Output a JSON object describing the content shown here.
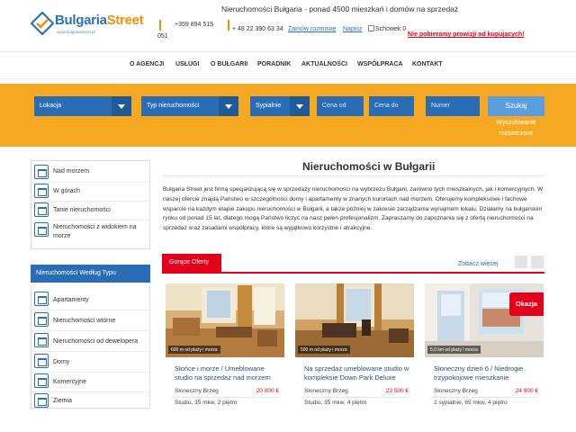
{
  "header": {
    "logo_text_a": "Bulgaria",
    "logo_text_b": "Street",
    "logo_sub": "www.bulgariastreet.pl",
    "title": "Nieruchomości Bułgaria - ponad 4500 mieszkań i domów na sprzedaż",
    "phone1_a": "+359 894 515",
    "phone1_b": "051",
    "phone2": "+ 48 22 390 63 34",
    "order_call": "Zamów rozmowę",
    "write": "Napisz",
    "schowek": "Schowek 0",
    "no_commission": "Nie pobieramy prowizji od kupujących!"
  },
  "menu": {
    "items": [
      "O AGENCJI",
      "USŁUGI",
      "O BUŁGARII",
      "PORADNIK",
      "AKTUALNOŚCI",
      "WSPÓŁPRACA",
      "KONTAKT"
    ]
  },
  "search": {
    "location": "Lokacja",
    "type": "Typ nieruchomości",
    "bedrooms": "Sypialnie",
    "price_from": "Cena od",
    "price_to": "Cena do",
    "number": "Numer",
    "button": "Szukaj",
    "advanced": "Wyszukiwanie rozszerzone"
  },
  "sidebar": {
    "top_items": [
      "Nad morzem",
      "W górach",
      "Tanie nieruchomości",
      "Nieruchomości z widokiem na morze"
    ],
    "heading": "Nieruchomości Według Typu",
    "type_items": [
      "Apartamenty",
      "Nieruchomości wtórne",
      "Nieruchomości od dewelopera",
      "Domy",
      "Komercyjne",
      "Ziemia"
    ]
  },
  "main": {
    "title": "Nieruchomości w Bułgarii",
    "intro": "Bulgaria Street jest firmą specjalizującą się w sprzedaży nieruchomości na wybrzeżu Bułgarii, zarówno tych mieszkalnych, jak i komercyjnych. W naszej ofercie znajdą Państwo w szczególności domy i apartamenty w znanych kurortach nad morzem. Oferujemy kompleksowe i fachowe wsparcie na każdym etapie zakupu nieruchomości w Bułgarii, a także później w zakresie zarządzania wynajmem lokalu. Działamy na bułgarskim rynku od ponad 15 lat, dlatego mogą Państwo liczyć na nasz pełen profesjonalizm. Zapraszamy do zapoznania się z ofertą nieruchomości na sprzedaż oraz zasadami współpracy, które są wyjątkowo korzystne i atrakcyjne.",
    "hot_tab": "Gorące Oferty",
    "see_more": "Zobacz więcej"
  },
  "cards": [
    {
      "distance": "600 m od plaży i morza",
      "title": "Słońce i morze / Umeblowane studio na sprzedaż nad morzem",
      "location": "Słoneczny Brzeg",
      "price": "20 000 €",
      "info": "Studio, 35 mkw, 2 piętro",
      "badge": ""
    },
    {
      "distance": "500 m od plaży i morza",
      "title": "Na sprzedaż umeblowane studio w kompleksie Down Park Deluxe",
      "location": "Słoneczny Brzeg",
      "price": "23 500 €",
      "info": "Studio, 35 mkw, 4 piętro",
      "badge": ""
    },
    {
      "distance": "5.0 km od plaży i morza",
      "title": "Słoneczny dzień 6 / Niedrogie trzypokojowe mieszkanie",
      "location": "Słoneczny Brzeg",
      "price": "24 900 €",
      "info": "2 sypialnie, 65 mkw, 4 piętro",
      "badge": "Okazja"
    }
  ],
  "colors": {
    "orange": "#f7a823",
    "blue": "#2b6db4",
    "red": "#e3001b"
  }
}
